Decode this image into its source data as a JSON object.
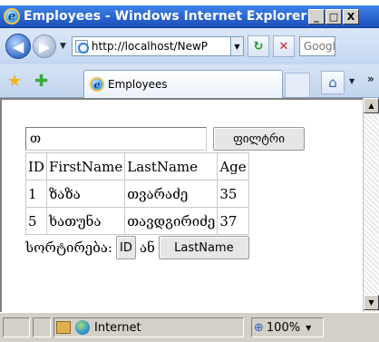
{
  "window": {
    "cutoff_text": "",
    "title": "Employees - Windows Internet Explorer",
    "minimize": "_",
    "maximize": "□",
    "close": "X"
  },
  "navbar": {
    "back_glyph": "◀",
    "forward_glyph": "▶",
    "dropdown_glyph": "▼",
    "address": "http://localhost/NewP",
    "refresh_glyph": "↻",
    "stop_glyph": "✕",
    "search_text": "Googl"
  },
  "tabs": {
    "active_label": "Employees",
    "home_glyph": "⌂",
    "chevron": "»"
  },
  "page": {
    "filter": {
      "input_value": "თ",
      "button_label": "ფილტრი"
    },
    "table": {
      "headers": [
        "ID",
        "FirstName",
        "LastName",
        "Age"
      ],
      "rows": [
        [
          "1",
          "ზაზა",
          "თვარაძე",
          "35"
        ],
        [
          "5",
          "ხათუნა",
          "თავდგირიძე",
          "37"
        ]
      ]
    },
    "sort": {
      "label": "სორტირება:",
      "id_button": "ID",
      "or_text": "ან",
      "lastname_button": "LastName"
    }
  },
  "statusbar": {
    "zone": "Internet",
    "zoom": "100%"
  },
  "colors": {
    "titlebar": "#2a64cf",
    "toolbar": "#d6e3f5",
    "statusbar": "#d4d0c8"
  }
}
